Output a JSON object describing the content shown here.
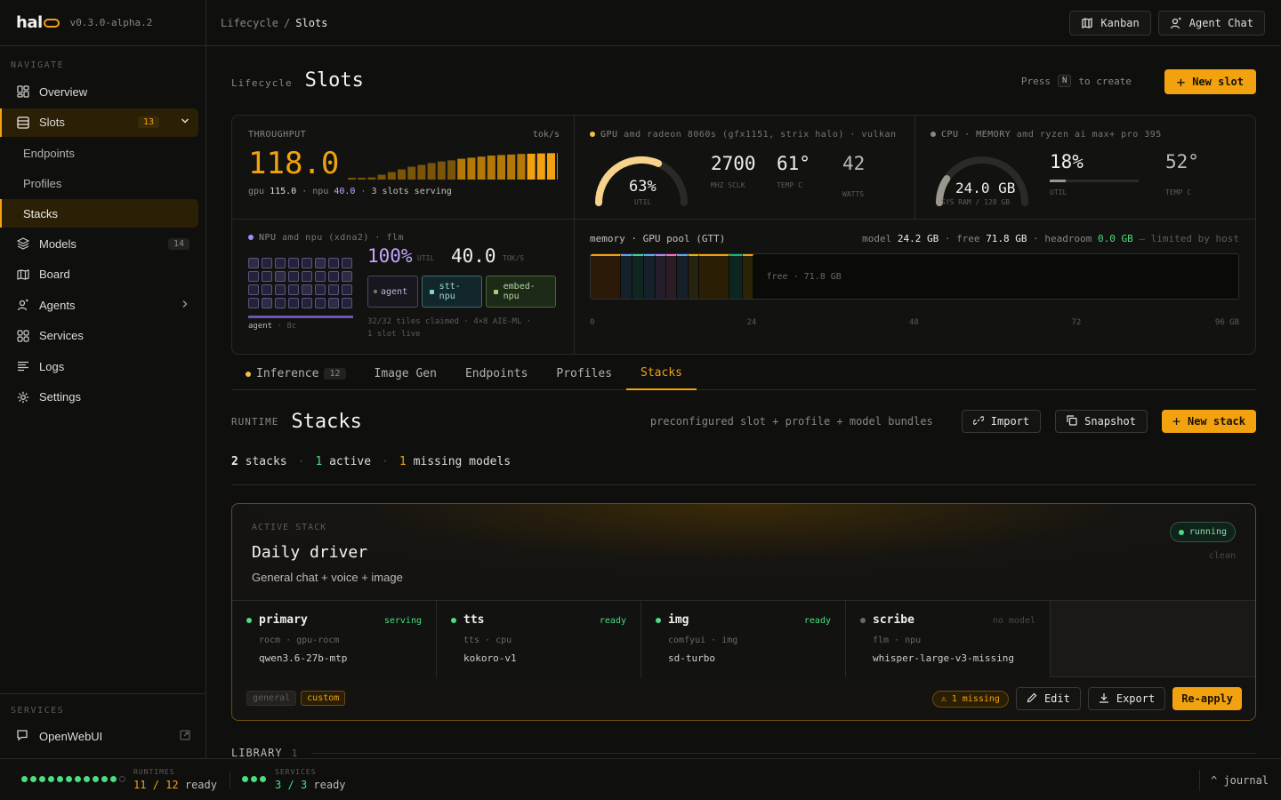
{
  "app": {
    "logo": "hal",
    "version": "v0.3.0-alpha.2"
  },
  "breadcrumb": {
    "parent": "Lifecycle",
    "sep": "/",
    "current": "Slots"
  },
  "topbar": {
    "kanban": "Kanban",
    "agent_chat": "Agent Chat"
  },
  "sidebar": {
    "nav_label": "NAVIGATE",
    "items": [
      {
        "label": "Overview"
      },
      {
        "label": "Slots",
        "badge": "13"
      },
      {
        "label": "Endpoints"
      },
      {
        "label": "Profiles"
      },
      {
        "label": "Stacks"
      },
      {
        "label": "Models",
        "badge": "14"
      },
      {
        "label": "Board"
      },
      {
        "label": "Agents"
      },
      {
        "label": "Services"
      },
      {
        "label": "Logs"
      },
      {
        "label": "Settings"
      }
    ],
    "services_label": "SERVICES",
    "service": "OpenWebUI"
  },
  "page": {
    "label": "Lifecycle",
    "title": "Slots",
    "press": "Press",
    "key": "N",
    "to_create": "to create",
    "new_slot": "New slot"
  },
  "throughput": {
    "label": "THROUGHPUT",
    "unit": "tok/s",
    "value": "118.0",
    "gpu_label": "gpu",
    "gpu": "115.0",
    "npu_label": "npu",
    "npu": "40.0",
    "serving": "3 slots serving",
    "bars": [
      0.05,
      0.06,
      0.08,
      0.18,
      0.28,
      0.38,
      0.48,
      0.55,
      0.62,
      0.68,
      0.72,
      0.78,
      0.82,
      0.86,
      0.9,
      0.92,
      0.94,
      0.96,
      0.97,
      0.98,
      0.99,
      1.0
    ]
  },
  "gpu": {
    "label": "GPU",
    "device": "amd radeon 8060s (gfx1151, strix halo) · vulkan",
    "util": 0.63,
    "util_text": "63%",
    "util_label": "UTIL",
    "sclk": "2700",
    "sclk_label": "MHZ SCLK",
    "temp": "61°",
    "temp_label": "TEMP C",
    "watts": "42",
    "watts_label": "WATTS"
  },
  "cpu": {
    "label": "CPU · MEMORY",
    "device": "amd ryzen ai max+ pro 395",
    "ram": "24.0 GB",
    "ram_label": "SYS RAM / 128 GB",
    "ram_frac": 0.19,
    "util": "18%",
    "util_label": "UTIL",
    "util_frac": 0.18,
    "temp": "52°",
    "temp_label": "TEMP C"
  },
  "npu": {
    "label": "NPU",
    "device": "amd npu (xdna2) · flm",
    "util": "100%",
    "util_label": "UTIL",
    "tok": "40.0",
    "tok_label": "TOK/S",
    "chips": [
      "agent",
      "stt-npu",
      "embed-npu"
    ],
    "legend": "agent",
    "legend_count": "8c",
    "tiles_text": "32/32 tiles claimed · 4×8 AIE-ML ·",
    "live_text": "1 slot live"
  },
  "memory": {
    "label": "memory · GPU pool (GTT)",
    "model_label": "model",
    "model": "24.2 GB",
    "free_label": "free",
    "free": "71.8 GB",
    "headroom_label": "headroom",
    "headroom": "0.0 GB",
    "limited": "— limited by host",
    "free_text": "free · 71.8 GB",
    "ticks": [
      "0",
      "24",
      "48",
      "72",
      "96 GB"
    ],
    "segments": [
      {
        "gb": 4.5,
        "color": "#2b1a08",
        "top": "#f2a20e"
      },
      {
        "gb": 1.7,
        "color": "#16202a",
        "top": "#60a5fa"
      },
      {
        "gb": 1.7,
        "color": "#0f2620",
        "top": "#34d399"
      },
      {
        "gb": 1.7,
        "color": "#16202a",
        "top": "#60a5fa"
      },
      {
        "gb": 1.6,
        "color": "#241d2c",
        "top": "#a78bfa"
      },
      {
        "gb": 1.6,
        "color": "#2c1d24",
        "top": "#f472b6"
      },
      {
        "gb": 1.7,
        "color": "#16202a",
        "top": "#60a5fa"
      },
      {
        "gb": 1.6,
        "color": "#262410",
        "top": "#eab308"
      },
      {
        "gb": 4.5,
        "color": "#2a1f05",
        "top": "#f2a20e"
      },
      {
        "gb": 1.9,
        "color": "#0b2621",
        "top": "#10b981"
      },
      {
        "gb": 1.7,
        "color": "#2a2306",
        "top": "#f2a20e"
      }
    ],
    "total_gb": 96
  },
  "tabs": [
    {
      "label": "Inference",
      "count": "12"
    },
    {
      "label": "Image Gen"
    },
    {
      "label": "Endpoints"
    },
    {
      "label": "Profiles"
    },
    {
      "label": "Stacks"
    }
  ],
  "stacks": {
    "runtime": "RUNTIME",
    "title": "Stacks",
    "desc": "preconfigured slot + profile + model bundles",
    "import": "Import",
    "snapshot": "Snapshot",
    "new_stack": "New stack",
    "summary": {
      "count": "2",
      "count_label": "stacks",
      "active": "1",
      "active_label": "active",
      "missing": "1",
      "missing_label": "missing models"
    },
    "library": "LIBRARY",
    "library_count": "1"
  },
  "active_stack": {
    "label": "ACTIVE STACK",
    "name": "Daily driver",
    "desc": "General chat + voice + image",
    "status": "running",
    "clean": "clean",
    "slots": [
      {
        "name": "primary",
        "state": "serving",
        "state_color": "#4ade80",
        "meta": "rocm · gpu-rocm",
        "model": "qwen3.6-27b-mtp",
        "dot": "#4ade80"
      },
      {
        "name": "tts",
        "state": "ready",
        "state_color": "#4ade80",
        "meta": "tts · cpu",
        "model": "kokoro-v1",
        "dot": "#4ade80"
      },
      {
        "name": "img",
        "state": "ready",
        "state_color": "#4ade80",
        "meta": "comfyui · img",
        "model": "sd-turbo",
        "dot": "#4ade80"
      },
      {
        "name": "scribe",
        "state": "no model",
        "state_color": "#5e5c56",
        "meta": "flm · npu",
        "model": "whisper-large-v3-missing",
        "dot": "#6b6963"
      }
    ],
    "tags": [
      "general",
      "custom"
    ],
    "missing": "⚠ 1 missing",
    "edit": "Edit",
    "export": "Export",
    "reapply": "Re-apply"
  },
  "footer": {
    "runtimes_label": "RUNTIMES",
    "runtimes_ready": "11",
    "runtimes_total": "12",
    "runtimes_suffix": "ready",
    "services_label": "SERVICES",
    "services_ready": "3",
    "services_total": "3",
    "services_suffix": "ready",
    "journal": "^ journal"
  }
}
